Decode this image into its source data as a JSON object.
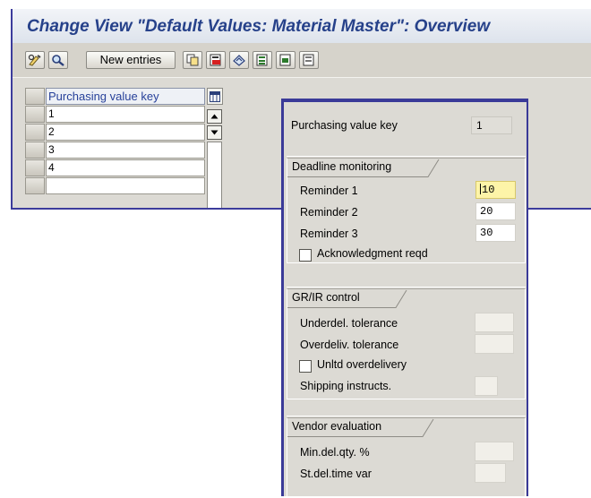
{
  "window": {
    "title": "Change View \"Default Values: Material Master\": Overview"
  },
  "toolbar": {
    "new_entries_label": "New entries",
    "icons": [
      "display-change-icon",
      "details-icon",
      "new-entries-button",
      "copy-as-icon",
      "delete-icon",
      "undo-change-icon",
      "select-all-icon",
      "select-block-icon",
      "deselect-all-icon"
    ]
  },
  "table": {
    "column_header": "Purchasing value key",
    "rows": [
      "1",
      "2",
      "3",
      "4",
      ""
    ]
  },
  "detail": {
    "key_label": "Purchasing value key",
    "key_value": "1",
    "deadline": {
      "title": "Deadline monitoring",
      "reminder1_label": "Reminder 1",
      "reminder1_value": "10",
      "reminder2_label": "Reminder 2",
      "reminder2_value": "20",
      "reminder3_label": "Reminder 3",
      "reminder3_value": "30",
      "ack_label": "Acknowledgment reqd",
      "ack_checked": false
    },
    "grir": {
      "title": "GR/IR control",
      "underdel_label": "Underdel. tolerance",
      "underdel_value": "",
      "overdel_label": "Overdeliv. tolerance",
      "overdel_value": "",
      "unltd_label": "Unltd overdelivery",
      "unltd_checked": false,
      "shipping_label": "Shipping instructs.",
      "shipping_value": ""
    },
    "vendor": {
      "title": "Vendor evaluation",
      "mindel_label": "Min.del.qty. %",
      "mindel_value": "",
      "stdel_label": "St.del.time var",
      "stdel_value": ""
    }
  }
}
